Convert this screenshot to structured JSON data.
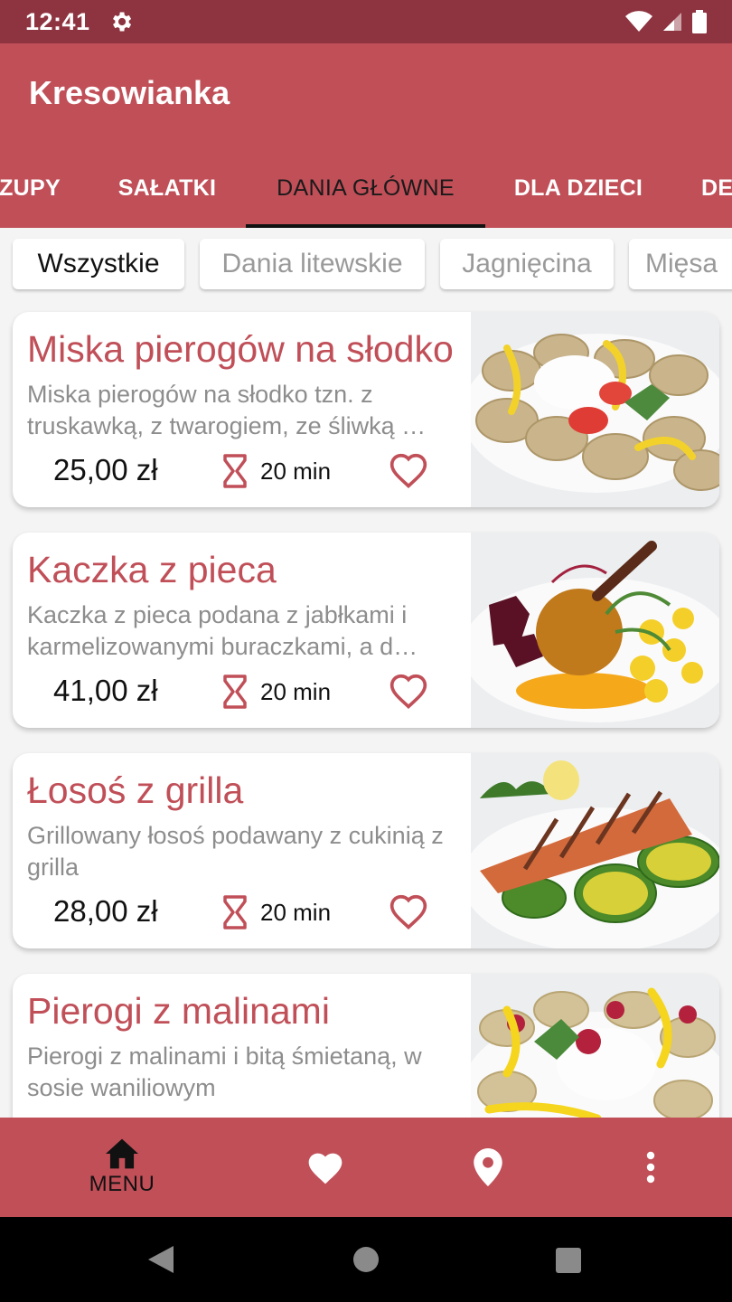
{
  "status_bar": {
    "time": "12:41"
  },
  "app": {
    "title": "Kresowianka"
  },
  "tabs": [
    {
      "label": "ZUPY"
    },
    {
      "label": "SAŁATKI"
    },
    {
      "label": "DANIA GŁÓWNE"
    },
    {
      "label": "DLA DZIECI"
    },
    {
      "label": "DE"
    }
  ],
  "filters": [
    {
      "label": "Wszystkie"
    },
    {
      "label": "Dania litewskie"
    },
    {
      "label": "Jagnięcina"
    },
    {
      "label": "Mięsa"
    }
  ],
  "dishes": [
    {
      "title": "Miska pierogów na słodko",
      "description": "Miska pierogów na słodko tzn. z truskawką, z twarogiem, ze śliwką …",
      "price": "25,00 zł",
      "time": "20 min"
    },
    {
      "title": "Kaczka z pieca",
      "description": "Kaczka z pieca podana z jabłkami i karmelizowanymi buraczkami, a d…",
      "price": "41,00 zł",
      "time": "20 min"
    },
    {
      "title": "Łosoś z grilla",
      "description": "Grillowany łosoś podawany z cukinią z grilla",
      "price": "28,00 zł",
      "time": "20 min"
    },
    {
      "title": "Pierogi z malinami",
      "description": "Pierogi z malinami i bitą śmietaną, w sosie waniliowym",
      "price": "",
      "time": ""
    }
  ],
  "bottom_nav": {
    "menu_label": "MENU"
  },
  "colors": {
    "primary": "#c04f58",
    "status_bar": "#8e3440",
    "text_muted": "#8d8d8d"
  }
}
